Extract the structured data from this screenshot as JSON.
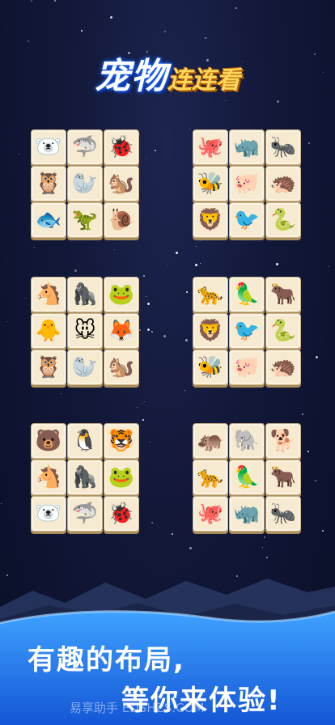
{
  "title": {
    "main": "宠物",
    "sub": "连连看"
  },
  "boards": [
    {
      "tiles": [
        "🐻‍❄️",
        "🦈",
        "🐞",
        "🦉",
        "🦭",
        "🐿️",
        "🐟",
        "🦖",
        "🐌"
      ]
    },
    {
      "tiles": [
        "🐙",
        "🦏",
        "🐜",
        "🐝",
        "🐖",
        "🦔",
        "🦁",
        "🐦",
        "🐍"
      ]
    },
    {
      "tiles": [
        "🐴",
        "🦍",
        "🐸",
        "🐥",
        "🐭",
        "🦊",
        "🦉",
        "🦭",
        "🐿️"
      ]
    },
    {
      "tiles": [
        "🐆",
        "🦜",
        "🐂",
        "🦁",
        "🐦",
        "🐍",
        "🐝",
        "🐖",
        "🦔"
      ]
    },
    {
      "tiles": [
        "🐻",
        "🐧",
        "🐯",
        "🐴",
        "🦍",
        "🐸",
        "🐻‍❄️",
        "🦈",
        "🐞"
      ]
    },
    {
      "tiles": [
        "🦛",
        "🐘",
        "🐕",
        "🐆",
        "🦜",
        "🐂",
        "🐙",
        "🦏",
        "🐜"
      ]
    }
  ],
  "slogan": {
    "line1": "有趣的布局,",
    "line2": "等你来体验!"
  },
  "watermark": "易享助手 EDSHZS.COM",
  "colors": {
    "tile": "#f6ead0",
    "title_glow": "#1b68ff",
    "title_sub": "#ffd65a",
    "wave": "#1f7ef0"
  }
}
